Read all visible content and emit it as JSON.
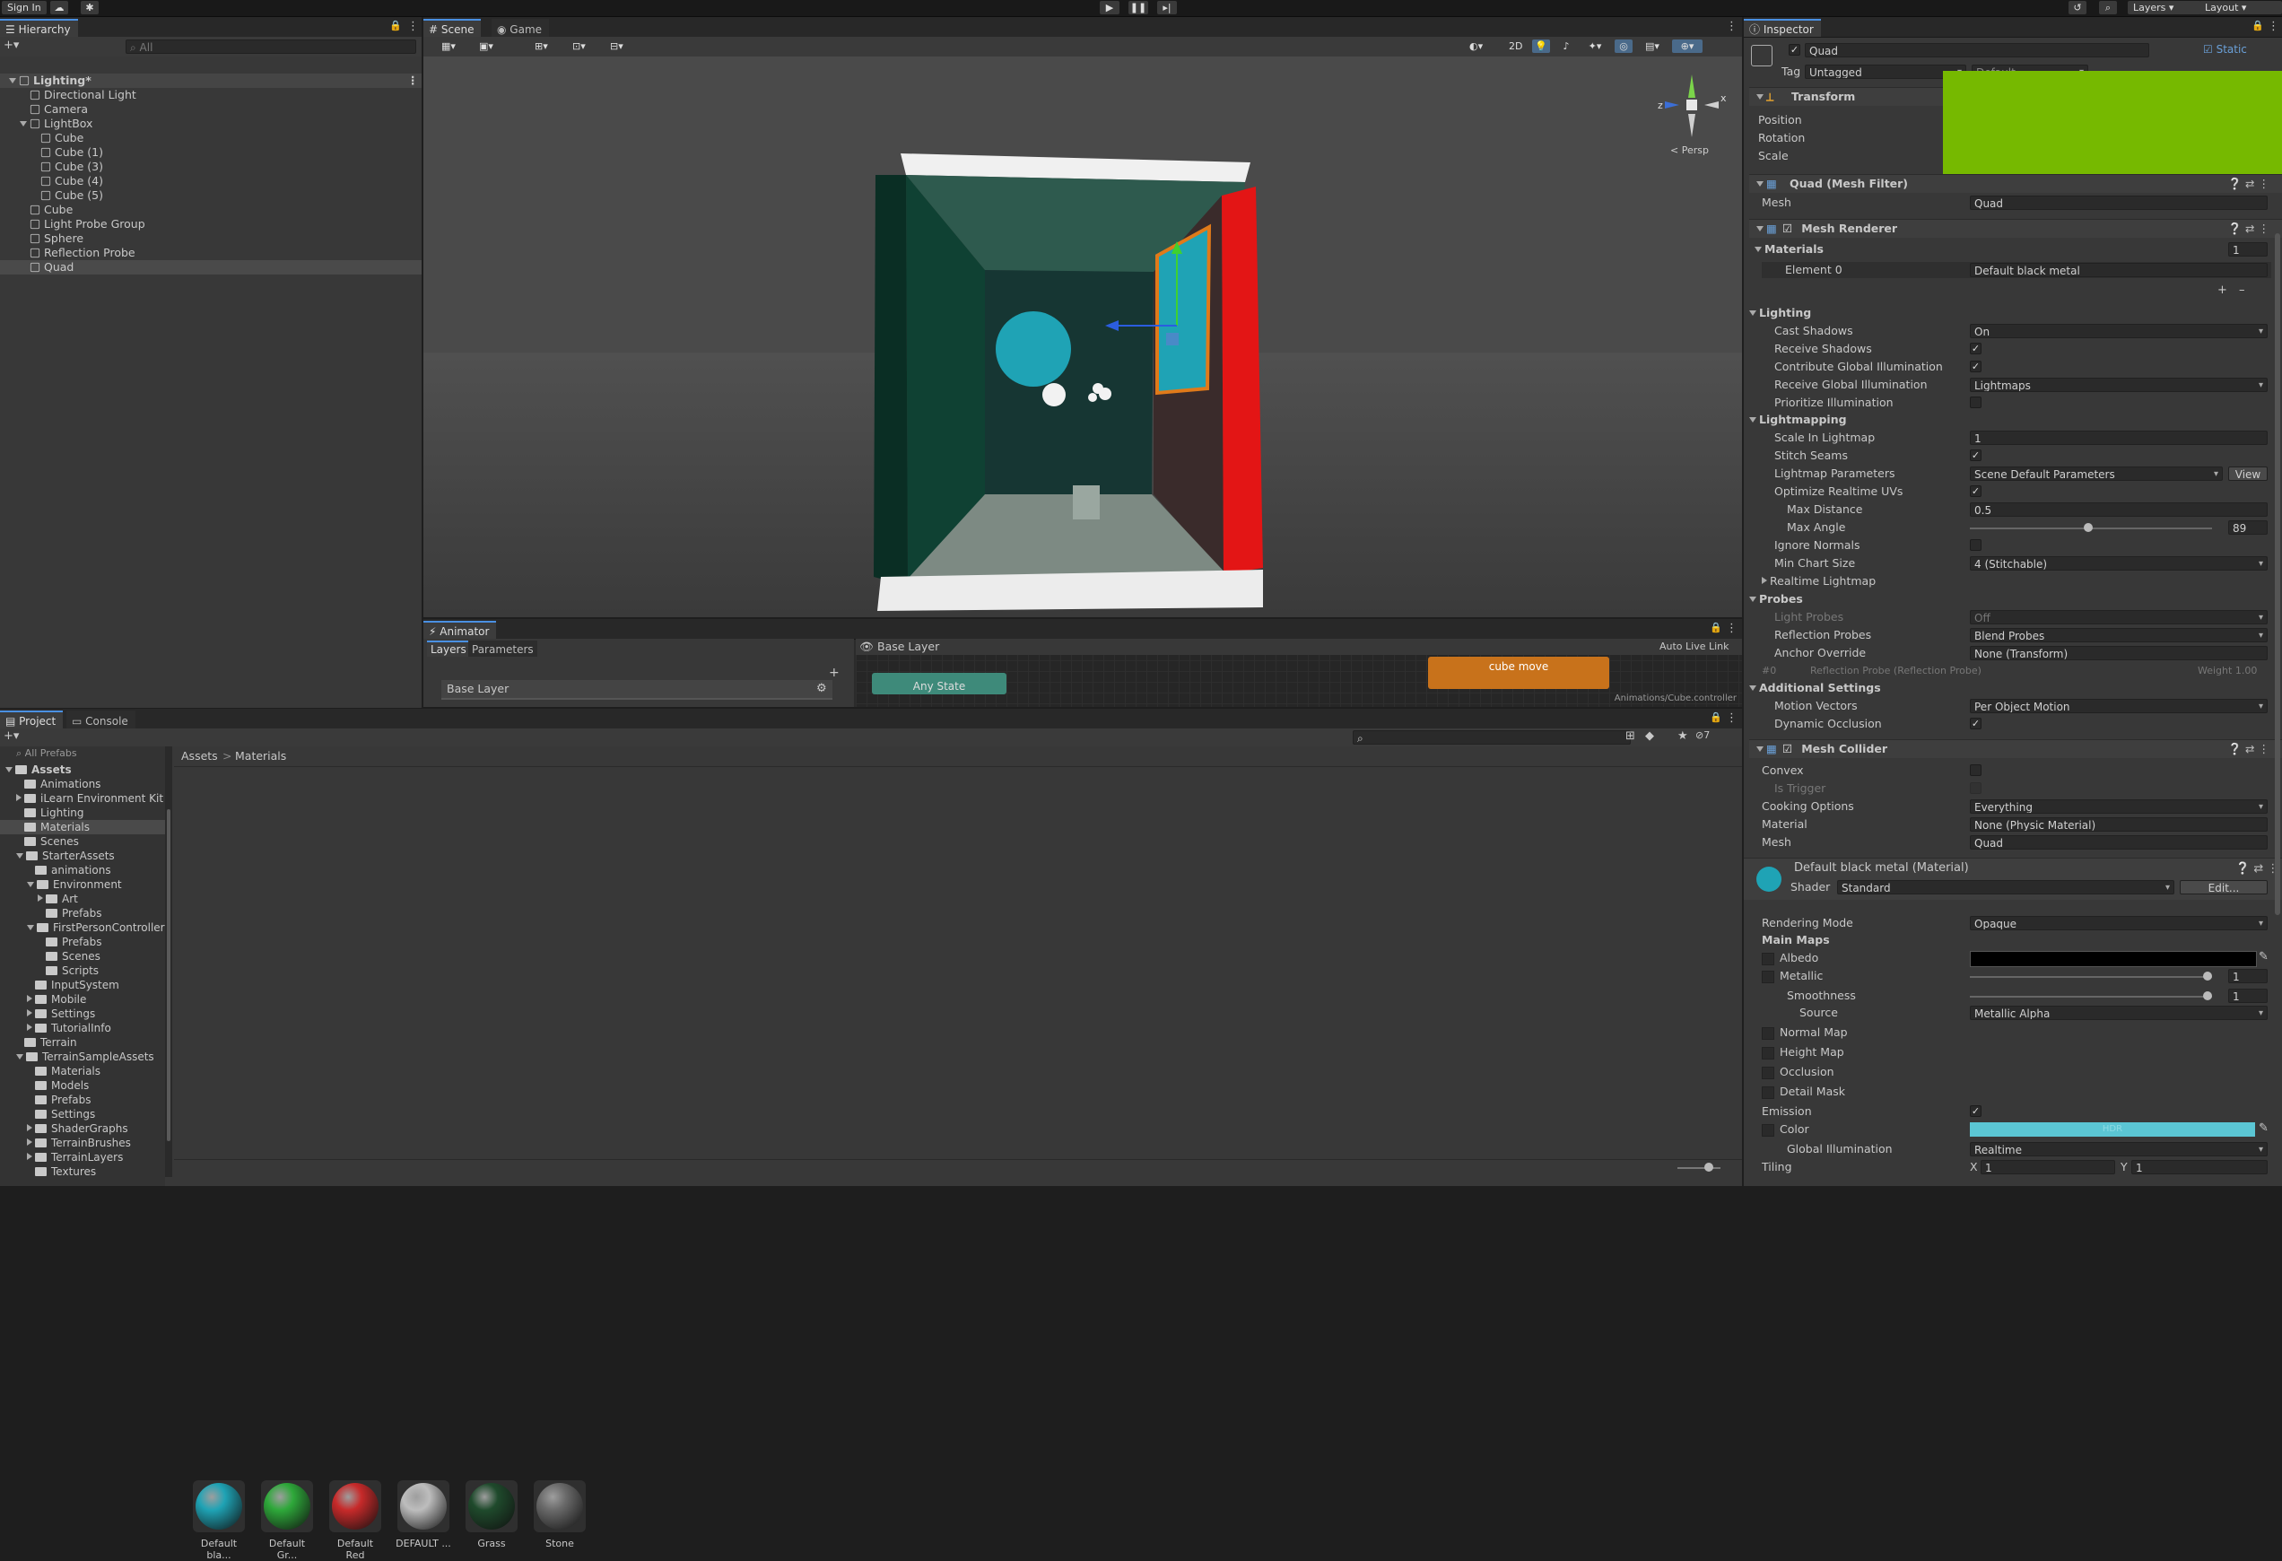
{
  "toolbar": {
    "sign_in": "Sign In",
    "layers": "Layers",
    "layout": "Layout"
  },
  "hierarchy": {
    "tab": "Hierarchy",
    "search_placeholder": "All",
    "items": [
      {
        "label": "Lighting*",
        "depth": 0
      },
      {
        "label": "Directional Light",
        "depth": 1
      },
      {
        "label": "Camera",
        "depth": 1
      },
      {
        "label": "LightBox",
        "depth": 1
      },
      {
        "label": "Cube",
        "depth": 2
      },
      {
        "label": "Cube (1)",
        "depth": 2
      },
      {
        "label": "Cube (3)",
        "depth": 2
      },
      {
        "label": "Cube (4)",
        "depth": 2
      },
      {
        "label": "Cube (5)",
        "depth": 2
      },
      {
        "label": "Cube",
        "depth": 1
      },
      {
        "label": "Light Probe Group",
        "depth": 1
      },
      {
        "label": "Sphere",
        "depth": 1
      },
      {
        "label": "Reflection Probe",
        "depth": 1
      },
      {
        "label": "Quad",
        "depth": 1
      }
    ]
  },
  "scene": {
    "tab_scene": "Scene",
    "tab_game": "Game",
    "btn_2d": "2D",
    "persp": "< Persp",
    "gizmo_x": "x",
    "gizmo_z": "z"
  },
  "animator": {
    "tab": "Animator",
    "layers_tab": "Layers",
    "params_tab": "Parameters",
    "base_layer_crumb": "Base Layer",
    "auto_live": "Auto Live Link",
    "layer_item": "Base Layer",
    "state_cube": "cube move",
    "state_any": "Any State",
    "controller_path": "Animations/Cube.controller"
  },
  "project": {
    "tab_project": "Project",
    "tab_console": "Console",
    "all_prefabs": "All Prefabs",
    "crumb_root": "Assets",
    "crumb_sep": ">",
    "crumb_leaf": "Materials",
    "tree": [
      {
        "label": "Assets",
        "depth": 0,
        "bold": true
      },
      {
        "label": "Animations",
        "depth": 1
      },
      {
        "label": "iLearn Environment Kit",
        "depth": 1
      },
      {
        "label": "Lighting",
        "depth": 1
      },
      {
        "label": "Materials",
        "depth": 1
      },
      {
        "label": "Scenes",
        "depth": 1
      },
      {
        "label": "StarterAssets",
        "depth": 1
      },
      {
        "label": "animations",
        "depth": 2
      },
      {
        "label": "Environment",
        "depth": 2
      },
      {
        "label": "Art",
        "depth": 3
      },
      {
        "label": "Prefabs",
        "depth": 3
      },
      {
        "label": "FirstPersonController",
        "depth": 2
      },
      {
        "label": "Prefabs",
        "depth": 3
      },
      {
        "label": "Scenes",
        "depth": 3
      },
      {
        "label": "Scripts",
        "depth": 3
      },
      {
        "label": "InputSystem",
        "depth": 2
      },
      {
        "label": "Mobile",
        "depth": 2
      },
      {
        "label": "Settings",
        "depth": 2
      },
      {
        "label": "TutorialInfo",
        "depth": 2
      },
      {
        "label": "Terrain",
        "depth": 1
      },
      {
        "label": "TerrainSampleAssets",
        "depth": 1
      },
      {
        "label": "Materials",
        "depth": 2
      },
      {
        "label": "Models",
        "depth": 2
      },
      {
        "label": "Prefabs",
        "depth": 2
      },
      {
        "label": "Settings",
        "depth": 2
      },
      {
        "label": "ShaderGraphs",
        "depth": 2
      },
      {
        "label": "TerrainBrushes",
        "depth": 2
      },
      {
        "label": "TerrainLayers",
        "depth": 2
      },
      {
        "label": "Textures",
        "depth": 2
      }
    ],
    "assets": [
      {
        "label": "Default bla...",
        "color": "#1fa3b5"
      },
      {
        "label": "Default Gr...",
        "color": "#2ea83a"
      },
      {
        "label": "Default Red",
        "color": "#c72a2a"
      },
      {
        "label": "DEFAULT ...",
        "color": "#bdbdbd"
      },
      {
        "label": "Grass",
        "color": "#1f4a2c"
      },
      {
        "label": "Stone",
        "color": "#6a6a6a"
      }
    ],
    "hidden_count": "7"
  },
  "inspector": {
    "tab": "Inspector",
    "object_name": "Quad",
    "static_label": "Static",
    "tag_label": "Tag",
    "tag_value": "Untagged",
    "layer_value": "Default",
    "transform": {
      "title": "Transform",
      "position": "Position",
      "rotation": "Rotation",
      "scale": "Scale"
    },
    "mesh_filter": {
      "title": "Quad (Mesh Filter)",
      "mesh_label": "Mesh",
      "mesh_value": "Quad"
    },
    "mesh_renderer": {
      "title": "Mesh Renderer",
      "materials": "Materials",
      "materials_count": "1",
      "element0": "Element 0",
      "element0_value": "Default black metal"
    },
    "lighting": {
      "title": "Lighting",
      "cast_shadows": "Cast Shadows",
      "cast_shadows_value": "On",
      "receive_shadows": "Receive Shadows",
      "contribute_gi": "Contribute Global Illumination",
      "receive_gi": "Receive Global Illumination",
      "receive_gi_value": "Lightmaps",
      "prioritize": "Prioritize Illumination"
    },
    "lightmapping": {
      "title": "Lightmapping",
      "scale": "Scale In Lightmap",
      "scale_value": "1",
      "stitch": "Stitch Seams",
      "params": "Lightmap Parameters",
      "params_value": "Scene Default Parameters",
      "view": "View",
      "optimize": "Optimize Realtime UVs",
      "max_distance": "Max Distance",
      "max_distance_value": "0.5",
      "max_angle": "Max Angle",
      "max_angle_value": "89",
      "max_angle_fraction": 0.49,
      "ignore_normals": "Ignore Normals",
      "min_chart": "Min Chart Size",
      "min_chart_value": "4 (Stitchable)",
      "realtime": "Realtime Lightmap"
    },
    "probes": {
      "title": "Probes",
      "light_probes": "Light Probes",
      "light_probes_value": "Off",
      "reflection": "Reflection Probes",
      "reflection_value": "Blend Probes",
      "anchor": "Anchor Override",
      "anchor_value": "None (Transform)",
      "probe_index": "#0",
      "probe_name": "Reflection Probe (Reflection Probe)",
      "weight": "Weight 1.00"
    },
    "additional": {
      "title": "Additional Settings",
      "motion": "Motion Vectors",
      "motion_value": "Per Object Motion",
      "dynamic": "Dynamic Occlusion"
    },
    "mesh_collider": {
      "title": "Mesh Collider",
      "convex": "Convex",
      "is_trigger": "Is Trigger",
      "cooking": "Cooking Options",
      "cooking_value": "Everything",
      "material": "Material",
      "material_value": "None (Physic Material)",
      "mesh": "Mesh",
      "mesh_value": "Quad"
    },
    "material": {
      "title": "Default black metal (Material)",
      "shader_label": "Shader",
      "shader_value": "Standard",
      "edit": "Edit...",
      "rendering_mode": "Rendering Mode",
      "rendering_mode_value": "Opaque",
      "main_maps": "Main Maps",
      "albedo": "Albedo",
      "metallic": "Metallic",
      "metallic_value": "1",
      "metallic_fraction": 0.98,
      "smoothness": "Smoothness",
      "smoothness_value": "1",
      "smoothness_fraction": 0.98,
      "source": "Source",
      "source_value": "Metallic Alpha",
      "normal": "Normal Map",
      "height": "Height Map",
      "occlusion": "Occlusion",
      "detail": "Detail Mask",
      "emission": "Emission",
      "color": "Color",
      "hdr": "HDR",
      "gi": "Global Illumination",
      "gi_value": "Realtime",
      "tiling": "Tiling",
      "tiling_x_label": "X",
      "tiling_x": "1",
      "tiling_y_label": "Y",
      "tiling_y": "1"
    }
  },
  "colors": {
    "selected": "#2c5d87",
    "accent": "#4a90e2",
    "orange": "#c8721b",
    "teal": "#1fa3b5",
    "green_overlay": "#76b900"
  }
}
